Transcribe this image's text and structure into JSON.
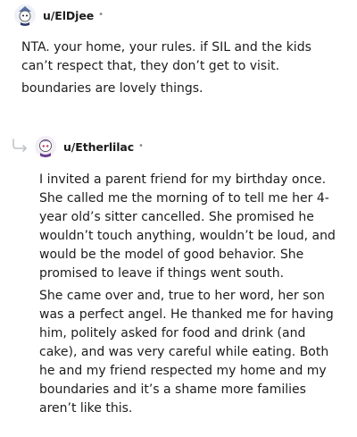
{
  "comments": [
    {
      "username": "u/ElDjee",
      "separator": "•",
      "avatar_icon": "snoo-avatar-icon",
      "paragraphs": [
        "NTA. your home, your rules. if SIL and the kids can’t respect that, they don’t get to visit.",
        "boundaries are lovely things."
      ]
    },
    {
      "username": "u/Etherlilac",
      "separator": "•",
      "avatar_icon": "snoo-avatar-icon",
      "reply_icon": "reply-arrow-icon",
      "paragraphs": [
        "I invited a parent friend for my birthday once. She called me the morning of to tell me her 4-year old’s sitter cancelled. She promised he wouldn’t touch anything, wouldn’t be loud, and would be the model of good behavior. She promised to leave if things went south.",
        "She came over and, true to her word, her son was a perfect angel. He thanked me for having him, politely asked for food and drink (and cake), and was very careful while eating. Both he and my friend respected my home and my boundaries and it’s a shame more families aren’t like this."
      ]
    }
  ]
}
